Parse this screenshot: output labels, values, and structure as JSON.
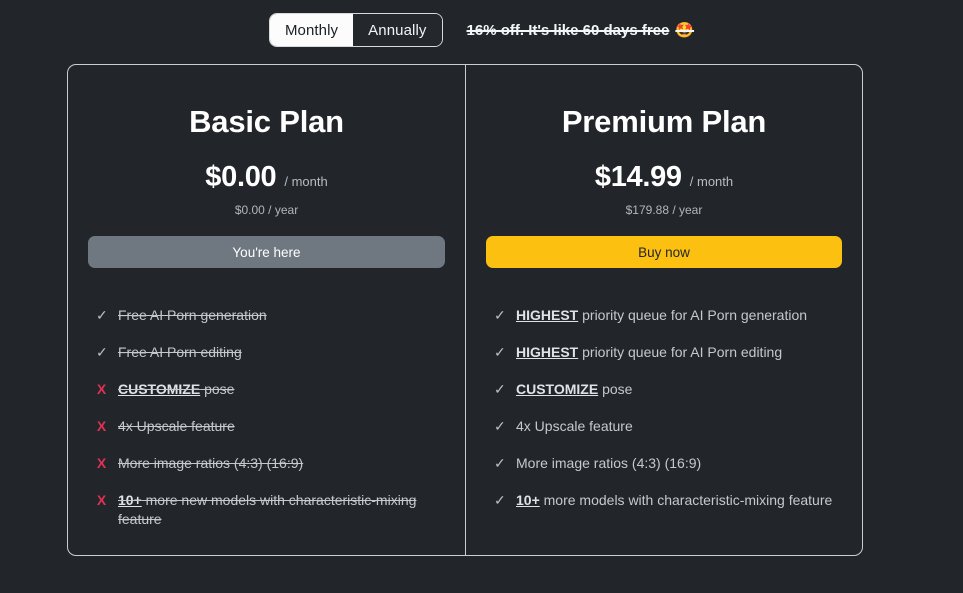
{
  "billing": {
    "options": [
      {
        "label": "Monthly",
        "active": true
      },
      {
        "label": "Annually",
        "active": false
      }
    ],
    "discount_text": "16% off. It's like 60 days free",
    "discount_emoji": "🤩"
  },
  "colors": {
    "page_background": "#22262a",
    "card_background": "#22262a",
    "card_border": "#c9ced4",
    "buy_button": "#fcc011",
    "here_button": "#6f7880",
    "cross_mark": "#e03155",
    "check_mark": "#b9bfc6",
    "toggle_active_bg": "#fcfcfc"
  },
  "plans": [
    {
      "name": "Basic Plan",
      "price": "$0.00",
      "period": "/ month",
      "yearly": "$0.00 / year",
      "cta_label": "You're here",
      "cta_style": "here",
      "features": [
        {
          "mark": "check",
          "enabled": true,
          "emphasis": "",
          "text": "Free AI Porn generation"
        },
        {
          "mark": "check",
          "enabled": true,
          "emphasis": "",
          "text": "Free AI Porn editing"
        },
        {
          "mark": "cross",
          "enabled": false,
          "emphasis": "CUSTOMIZE",
          "text": " pose"
        },
        {
          "mark": "cross",
          "enabled": false,
          "emphasis": "",
          "text": "4x Upscale feature"
        },
        {
          "mark": "cross",
          "enabled": false,
          "emphasis": "",
          "text": "More image ratios (4:3) (16:9)"
        },
        {
          "mark": "cross",
          "enabled": false,
          "emphasis": "10+",
          "text": " more new models with characteristic-mixing feature"
        }
      ]
    },
    {
      "name": "Premium Plan",
      "price": "$14.99",
      "period": "/ month",
      "yearly": "$179.88 / year",
      "cta_label": "Buy now",
      "cta_style": "buy",
      "features": [
        {
          "mark": "check",
          "enabled": true,
          "emphasis": "HIGHEST",
          "text": " priority queue for AI Porn generation"
        },
        {
          "mark": "check",
          "enabled": true,
          "emphasis": "HIGHEST",
          "text": " priority queue for AI Porn editing"
        },
        {
          "mark": "check",
          "enabled": true,
          "emphasis": "CUSTOMIZE",
          "text": " pose"
        },
        {
          "mark": "check",
          "enabled": true,
          "emphasis": "",
          "text": "4x Upscale feature"
        },
        {
          "mark": "check",
          "enabled": true,
          "emphasis": "",
          "text": "More image ratios (4:3) (16:9)"
        },
        {
          "mark": "check",
          "enabled": true,
          "emphasis": "10+",
          "text": " more models with characteristic-mixing feature"
        }
      ]
    }
  ],
  "glyphs": {
    "check": "✓",
    "cross": "X"
  }
}
